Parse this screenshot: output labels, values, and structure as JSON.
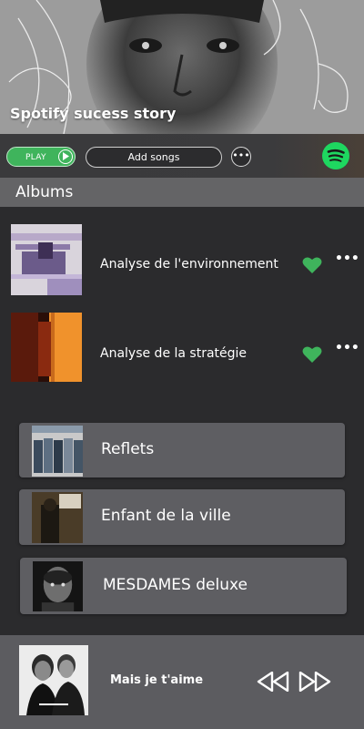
{
  "hero": {
    "title": "Spotify sucess story"
  },
  "controls": {
    "play_label": "PLAY",
    "add_label": "Add songs",
    "more_label": "•••"
  },
  "albums": {
    "header": "Albums",
    "items": [
      {
        "name": "Analyse de l'environnement",
        "liked": true,
        "more": "•••"
      },
      {
        "name": "Analyse de la stratégie",
        "liked": true,
        "more": "•••"
      }
    ]
  },
  "playlists": [
    {
      "name": "Reflets"
    },
    {
      "name": "Enfant de la ville"
    },
    {
      "name": "MESDAMES deluxe"
    }
  ],
  "now_playing": {
    "title": "Mais je t'aime"
  },
  "colors": {
    "accent_green": "#3fb45c",
    "spotify_green": "#1ed760",
    "background": "#2b2b2d",
    "header_gray": "#646466",
    "card_gray": "#5e5e62"
  }
}
